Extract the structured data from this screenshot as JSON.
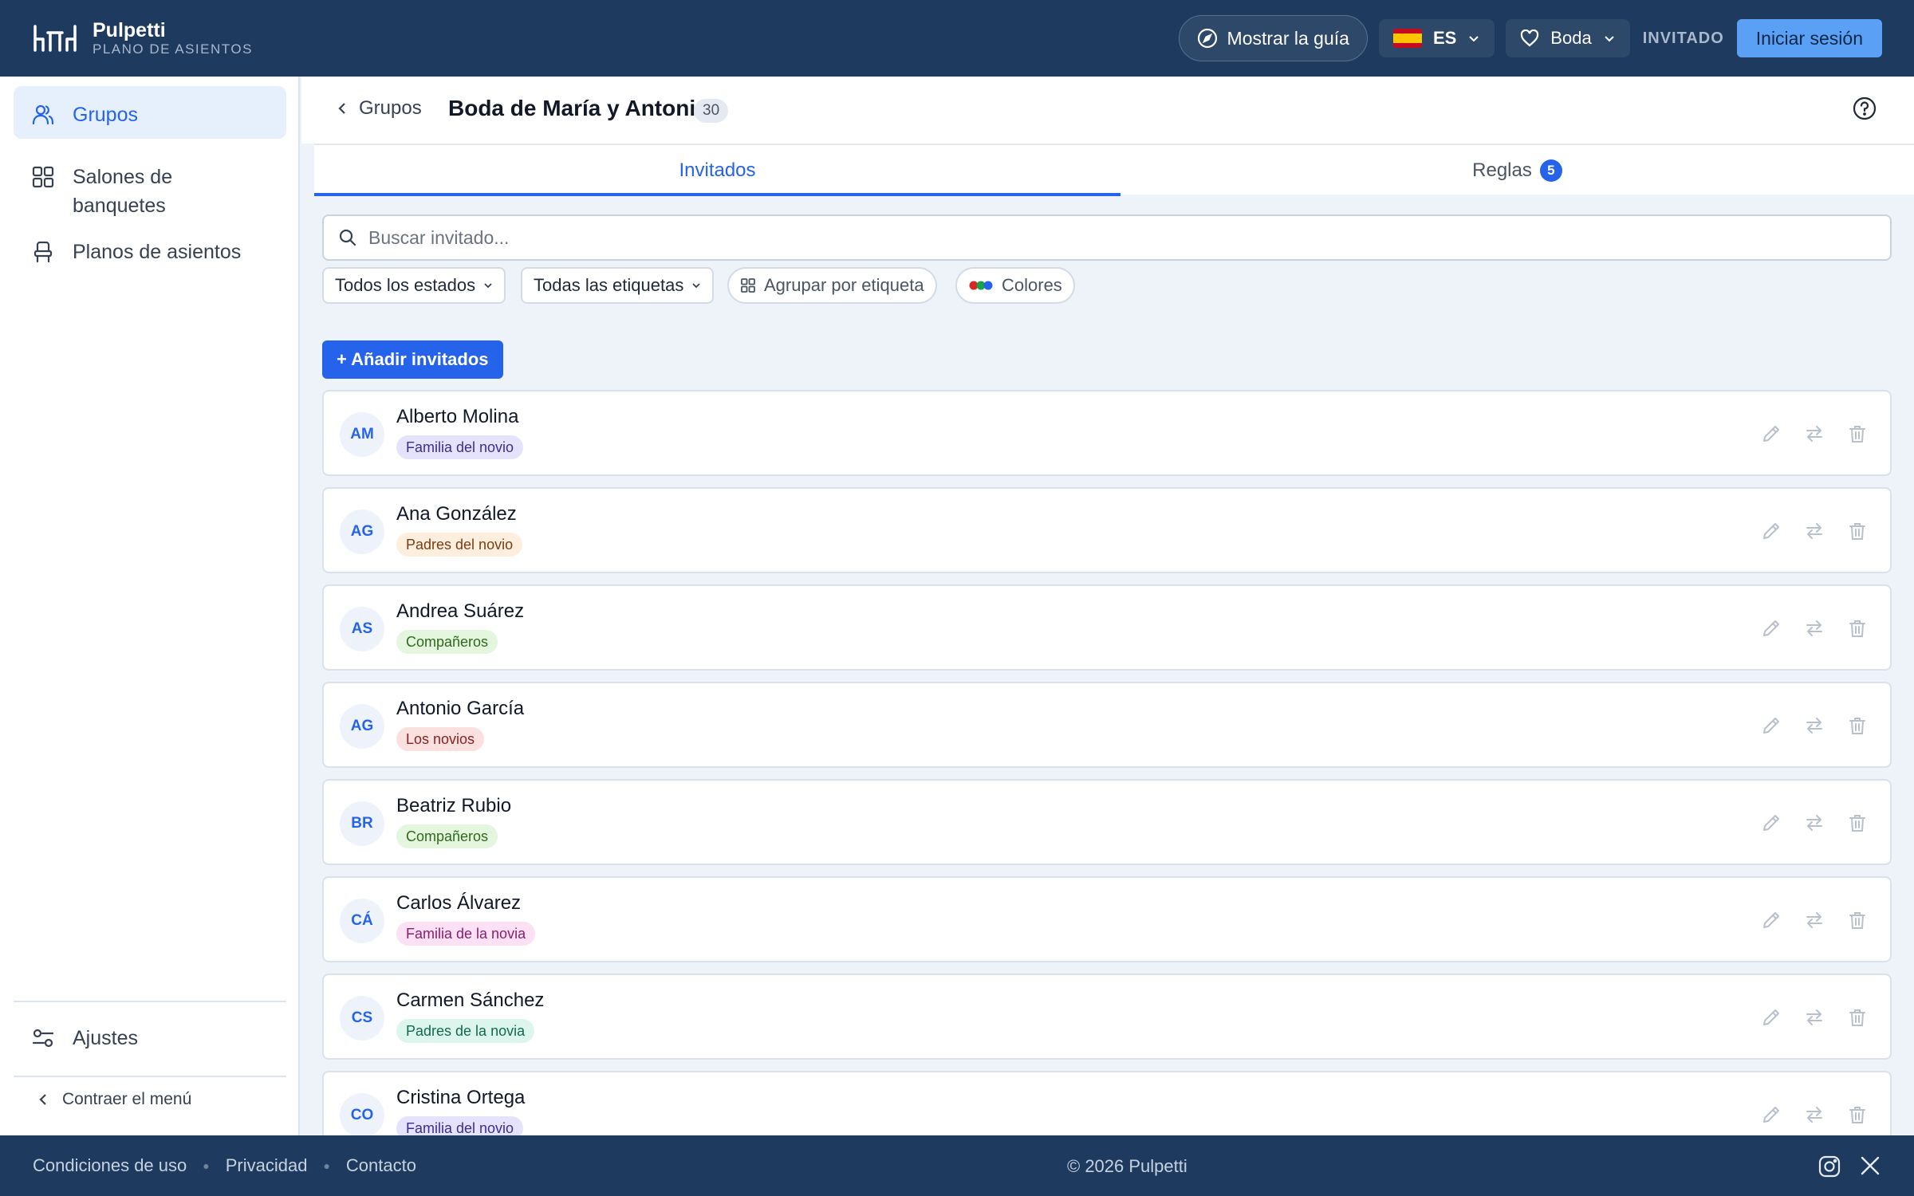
{
  "app": {
    "name": "Pulpetti",
    "subtitle": "PLANO DE ASIENTOS"
  },
  "header": {
    "guide_label": "Mostrar la guía",
    "lang_code": "ES",
    "event_label": "Boda",
    "role_label": "INVITADO",
    "login_label": "Iniciar sesión"
  },
  "sidebar": {
    "items": [
      {
        "label": "Grupos",
        "icon": "users-icon",
        "active": true
      },
      {
        "label": "Salones de banquetes",
        "icon": "grid-icon",
        "active": false
      },
      {
        "label": "Planos de asientos",
        "icon": "chair-icon",
        "active": false
      }
    ],
    "settings_label": "Ajustes",
    "collapse_label": "Contraer el menú"
  },
  "page": {
    "back_label": "Grupos",
    "title": "Boda de María y Antonio",
    "count": "30",
    "tabs": [
      {
        "label": "Invitados",
        "active": true
      },
      {
        "label": "Reglas",
        "badge": "5"
      }
    ],
    "search_placeholder": "Buscar invitado...",
    "filters": {
      "status": "Todos los estados",
      "labels": "Todas las etiquetas",
      "group_by": "Agrupar por etiqueta",
      "colors": "Colores"
    },
    "add_label": "+ Añadir invitados"
  },
  "guests": [
    {
      "initials": "AM",
      "name": "Alberto Molina",
      "tag": "Familia del novio",
      "tag_bg": "#e5e3fb",
      "tag_color": "#3b2f8f"
    },
    {
      "initials": "AG",
      "name": "Ana González",
      "tag": "Padres del novio",
      "tag_bg": "#fdeedd",
      "tag_color": "#7a3e12"
    },
    {
      "initials": "AS",
      "name": "Andrea Suárez",
      "tag": "Compañeros",
      "tag_bg": "#e4f6dd",
      "tag_color": "#2f6a1c"
    },
    {
      "initials": "AG",
      "name": "Antonio García",
      "tag": "Los novios",
      "tag_bg": "#fbe0e0",
      "tag_color": "#8c1f1f"
    },
    {
      "initials": "BR",
      "name": "Beatriz Rubio",
      "tag": "Compañeros",
      "tag_bg": "#e4f6dd",
      "tag_color": "#2f6a1c"
    },
    {
      "initials": "CÁ",
      "name": "Carlos Álvarez",
      "tag": "Familia de la novia",
      "tag_bg": "#fbe1f3",
      "tag_color": "#8a1f6d"
    },
    {
      "initials": "CS",
      "name": "Carmen Sánchez",
      "tag": "Padres de la novia",
      "tag_bg": "#dcf6ee",
      "tag_color": "#136a4d"
    },
    {
      "initials": "CO",
      "name": "Cristina Ortega",
      "tag": "Familia del novio",
      "tag_bg": "#e5e3fb",
      "tag_color": "#3b2f8f"
    }
  ],
  "footer": {
    "links": [
      "Condiciones de uso",
      "Privacidad",
      "Contacto"
    ],
    "copyright": "© 2026 Pulpetti"
  },
  "colors": {
    "header_bg": "#1e3a5f",
    "accent": "#2563eb",
    "login_bg": "#5aa1f5"
  }
}
